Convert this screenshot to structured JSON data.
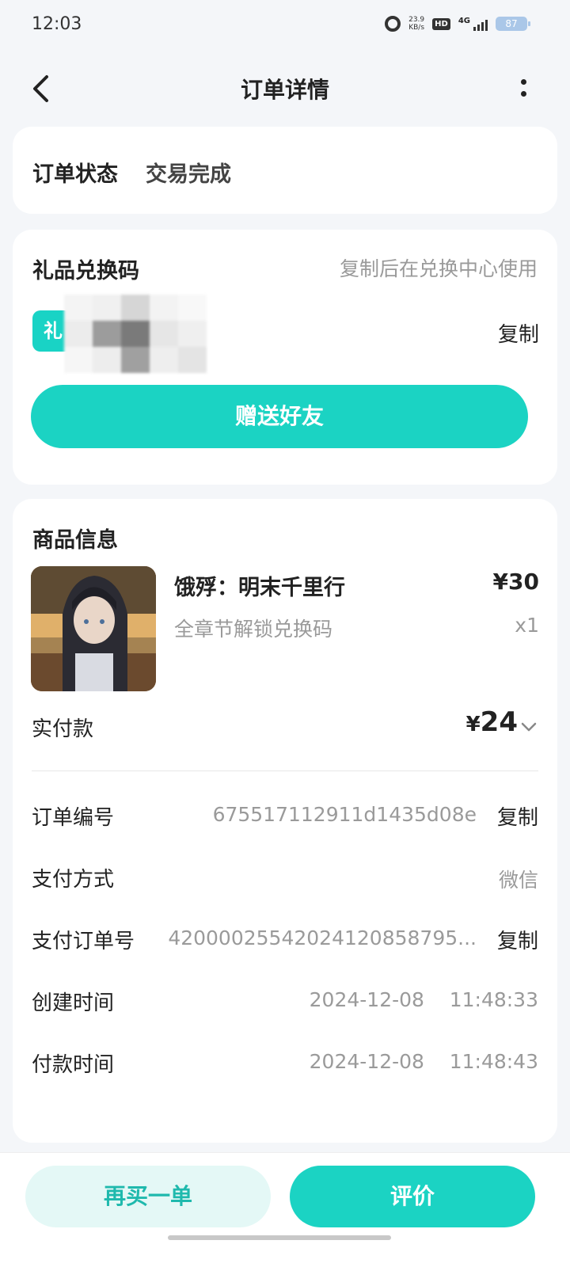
{
  "status_bar": {
    "time": "12:03",
    "net_speed_value": "23.9",
    "net_speed_unit": "KB/s",
    "hd_label": "HD",
    "signal_label": "4G",
    "battery": "87"
  },
  "nav": {
    "title": "订单详情"
  },
  "order_status": {
    "label": "订单状态",
    "value": "交易完成"
  },
  "gift_code": {
    "title": "礼品兑换码",
    "hint": "复制后在兑换中心使用",
    "copy_label": "复制",
    "send_button": "赠送好友"
  },
  "product": {
    "section_title": "商品信息",
    "name": "饿殍：明末千里行",
    "price": "¥30",
    "subtitle": "全章节解锁兑换码",
    "quantity": "x1"
  },
  "payment": {
    "label": "实付款",
    "currency": "¥",
    "amount": "24"
  },
  "details": [
    {
      "label": "订单编号",
      "value": "675517112911d1435d08e",
      "copy": "复制"
    },
    {
      "label": "支付方式",
      "value": "微信",
      "copy": ""
    },
    {
      "label": "支付订单号",
      "value": "42000025542024120858795...",
      "copy": "复制"
    },
    {
      "label": "创建时间",
      "value": "2024-12-08    11:48:33",
      "copy": ""
    },
    {
      "label": "付款时间",
      "value": "2024-12-08    11:48:43",
      "copy": ""
    }
  ],
  "bottom": {
    "rebuy": "再买一单",
    "review": "评价"
  },
  "colors": {
    "accent": "#1bd3c3",
    "accent_light": "#e4f8f6",
    "background": "#f4f6f9"
  }
}
